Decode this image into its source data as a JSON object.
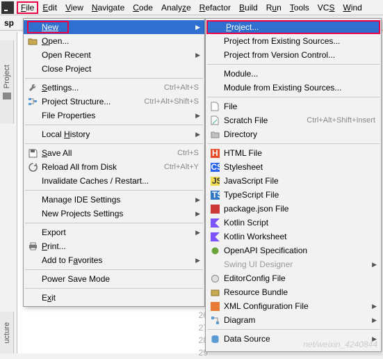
{
  "menubar": {
    "items": [
      "File",
      "Edit",
      "View",
      "Navigate",
      "Code",
      "Analyze",
      "Refactor",
      "Build",
      "Run",
      "Tools",
      "VCS",
      "Wind"
    ]
  },
  "toolbar": {
    "project_prefix": "sp"
  },
  "side": {
    "project": "Project",
    "structure": "ucture"
  },
  "gutter": {
    "lines": [
      "26",
      "27",
      "28",
      "29"
    ]
  },
  "watermark": "net/weixin_4240844",
  "file_menu": {
    "new": "New",
    "open": "Open...",
    "open_recent": "Open Recent",
    "close_project": "Close Project",
    "settings": "Settings...",
    "settings_sc": "Ctrl+Alt+S",
    "project_structure": "Project Structure...",
    "project_structure_sc": "Ctrl+Alt+Shift+S",
    "file_properties": "File Properties",
    "local_history": "Local History",
    "save_all": "Save All",
    "save_all_sc": "Ctrl+S",
    "reload": "Reload All from Disk",
    "reload_sc": "Ctrl+Alt+Y",
    "invalidate": "Invalidate Caches / Restart...",
    "manage_ide": "Manage IDE Settings",
    "new_proj_settings": "New Projects Settings",
    "export": "Export",
    "print": "Print...",
    "favorites": "Add to Favorites",
    "power_save": "Power Save Mode",
    "exit": "Exit"
  },
  "new_menu": {
    "project": "Project...",
    "existing": "Project from Existing Sources...",
    "vcs": "Project from Version Control...",
    "module": "Module...",
    "module_existing": "Module from Existing Sources...",
    "file": "File",
    "scratch": "Scratch File",
    "scratch_sc": "Ctrl+Alt+Shift+Insert",
    "directory": "Directory",
    "html": "HTML File",
    "stylesheet": "Stylesheet",
    "javascript": "JavaScript File",
    "typescript": "TypeScript File",
    "package_json": "package.json File",
    "kotlin_script": "Kotlin Script",
    "kotlin_ws": "Kotlin Worksheet",
    "openapi": "OpenAPI Specification",
    "swing": "Swing UI Designer",
    "editorconfig": "EditorConfig File",
    "resource_bundle": "Resource Bundle",
    "xml_config": "XML Configuration File",
    "diagram": "Diagram",
    "data_source": "Data Source"
  }
}
